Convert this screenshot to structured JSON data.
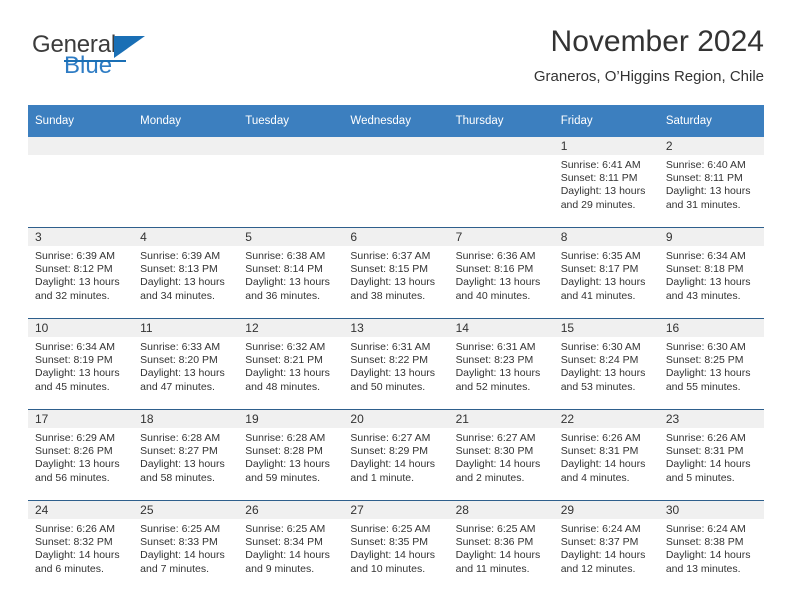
{
  "brand": {
    "name_top": "General",
    "name_bottom": "Blue",
    "accent_color": "#2e7cc4"
  },
  "header": {
    "title": "November 2024",
    "subtitle": "Graneros, O’Higgins Region, Chile"
  },
  "theme": {
    "header_row_bg": "#3c7fbf",
    "row_divider": "#2e5f8c",
    "daynum_band_bg": "#f0f0f0",
    "text": "#333333"
  },
  "weekday_headers": [
    "Sunday",
    "Monday",
    "Tuesday",
    "Wednesday",
    "Thursday",
    "Friday",
    "Saturday"
  ],
  "weeks": [
    [
      {
        "day": "",
        "lines": []
      },
      {
        "day": "",
        "lines": []
      },
      {
        "day": "",
        "lines": []
      },
      {
        "day": "",
        "lines": []
      },
      {
        "day": "",
        "lines": []
      },
      {
        "day": "1",
        "lines": [
          "Sunrise: 6:41 AM",
          "Sunset: 8:11 PM",
          "Daylight: 13 hours",
          "and 29 minutes."
        ]
      },
      {
        "day": "2",
        "lines": [
          "Sunrise: 6:40 AM",
          "Sunset: 8:11 PM",
          "Daylight: 13 hours",
          "and 31 minutes."
        ]
      }
    ],
    [
      {
        "day": "3",
        "lines": [
          "Sunrise: 6:39 AM",
          "Sunset: 8:12 PM",
          "Daylight: 13 hours",
          "and 32 minutes."
        ]
      },
      {
        "day": "4",
        "lines": [
          "Sunrise: 6:39 AM",
          "Sunset: 8:13 PM",
          "Daylight: 13 hours",
          "and 34 minutes."
        ]
      },
      {
        "day": "5",
        "lines": [
          "Sunrise: 6:38 AM",
          "Sunset: 8:14 PM",
          "Daylight: 13 hours",
          "and 36 minutes."
        ]
      },
      {
        "day": "6",
        "lines": [
          "Sunrise: 6:37 AM",
          "Sunset: 8:15 PM",
          "Daylight: 13 hours",
          "and 38 minutes."
        ]
      },
      {
        "day": "7",
        "lines": [
          "Sunrise: 6:36 AM",
          "Sunset: 8:16 PM",
          "Daylight: 13 hours",
          "and 40 minutes."
        ]
      },
      {
        "day": "8",
        "lines": [
          "Sunrise: 6:35 AM",
          "Sunset: 8:17 PM",
          "Daylight: 13 hours",
          "and 41 minutes."
        ]
      },
      {
        "day": "9",
        "lines": [
          "Sunrise: 6:34 AM",
          "Sunset: 8:18 PM",
          "Daylight: 13 hours",
          "and 43 minutes."
        ]
      }
    ],
    [
      {
        "day": "10",
        "lines": [
          "Sunrise: 6:34 AM",
          "Sunset: 8:19 PM",
          "Daylight: 13 hours",
          "and 45 minutes."
        ]
      },
      {
        "day": "11",
        "lines": [
          "Sunrise: 6:33 AM",
          "Sunset: 8:20 PM",
          "Daylight: 13 hours",
          "and 47 minutes."
        ]
      },
      {
        "day": "12",
        "lines": [
          "Sunrise: 6:32 AM",
          "Sunset: 8:21 PM",
          "Daylight: 13 hours",
          "and 48 minutes."
        ]
      },
      {
        "day": "13",
        "lines": [
          "Sunrise: 6:31 AM",
          "Sunset: 8:22 PM",
          "Daylight: 13 hours",
          "and 50 minutes."
        ]
      },
      {
        "day": "14",
        "lines": [
          "Sunrise: 6:31 AM",
          "Sunset: 8:23 PM",
          "Daylight: 13 hours",
          "and 52 minutes."
        ]
      },
      {
        "day": "15",
        "lines": [
          "Sunrise: 6:30 AM",
          "Sunset: 8:24 PM",
          "Daylight: 13 hours",
          "and 53 minutes."
        ]
      },
      {
        "day": "16",
        "lines": [
          "Sunrise: 6:30 AM",
          "Sunset: 8:25 PM",
          "Daylight: 13 hours",
          "and 55 minutes."
        ]
      }
    ],
    [
      {
        "day": "17",
        "lines": [
          "Sunrise: 6:29 AM",
          "Sunset: 8:26 PM",
          "Daylight: 13 hours",
          "and 56 minutes."
        ]
      },
      {
        "day": "18",
        "lines": [
          "Sunrise: 6:28 AM",
          "Sunset: 8:27 PM",
          "Daylight: 13 hours",
          "and 58 minutes."
        ]
      },
      {
        "day": "19",
        "lines": [
          "Sunrise: 6:28 AM",
          "Sunset: 8:28 PM",
          "Daylight: 13 hours",
          "and 59 minutes."
        ]
      },
      {
        "day": "20",
        "lines": [
          "Sunrise: 6:27 AM",
          "Sunset: 8:29 PM",
          "Daylight: 14 hours",
          "and 1 minute."
        ]
      },
      {
        "day": "21",
        "lines": [
          "Sunrise: 6:27 AM",
          "Sunset: 8:30 PM",
          "Daylight: 14 hours",
          "and 2 minutes."
        ]
      },
      {
        "day": "22",
        "lines": [
          "Sunrise: 6:26 AM",
          "Sunset: 8:31 PM",
          "Daylight: 14 hours",
          "and 4 minutes."
        ]
      },
      {
        "day": "23",
        "lines": [
          "Sunrise: 6:26 AM",
          "Sunset: 8:31 PM",
          "Daylight: 14 hours",
          "and 5 minutes."
        ]
      }
    ],
    [
      {
        "day": "24",
        "lines": [
          "Sunrise: 6:26 AM",
          "Sunset: 8:32 PM",
          "Daylight: 14 hours",
          "and 6 minutes."
        ]
      },
      {
        "day": "25",
        "lines": [
          "Sunrise: 6:25 AM",
          "Sunset: 8:33 PM",
          "Daylight: 14 hours",
          "and 7 minutes."
        ]
      },
      {
        "day": "26",
        "lines": [
          "Sunrise: 6:25 AM",
          "Sunset: 8:34 PM",
          "Daylight: 14 hours",
          "and 9 minutes."
        ]
      },
      {
        "day": "27",
        "lines": [
          "Sunrise: 6:25 AM",
          "Sunset: 8:35 PM",
          "Daylight: 14 hours",
          "and 10 minutes."
        ]
      },
      {
        "day": "28",
        "lines": [
          "Sunrise: 6:25 AM",
          "Sunset: 8:36 PM",
          "Daylight: 14 hours",
          "and 11 minutes."
        ]
      },
      {
        "day": "29",
        "lines": [
          "Sunrise: 6:24 AM",
          "Sunset: 8:37 PM",
          "Daylight: 14 hours",
          "and 12 minutes."
        ]
      },
      {
        "day": "30",
        "lines": [
          "Sunrise: 6:24 AM",
          "Sunset: 8:38 PM",
          "Daylight: 14 hours",
          "and 13 minutes."
        ]
      }
    ]
  ]
}
